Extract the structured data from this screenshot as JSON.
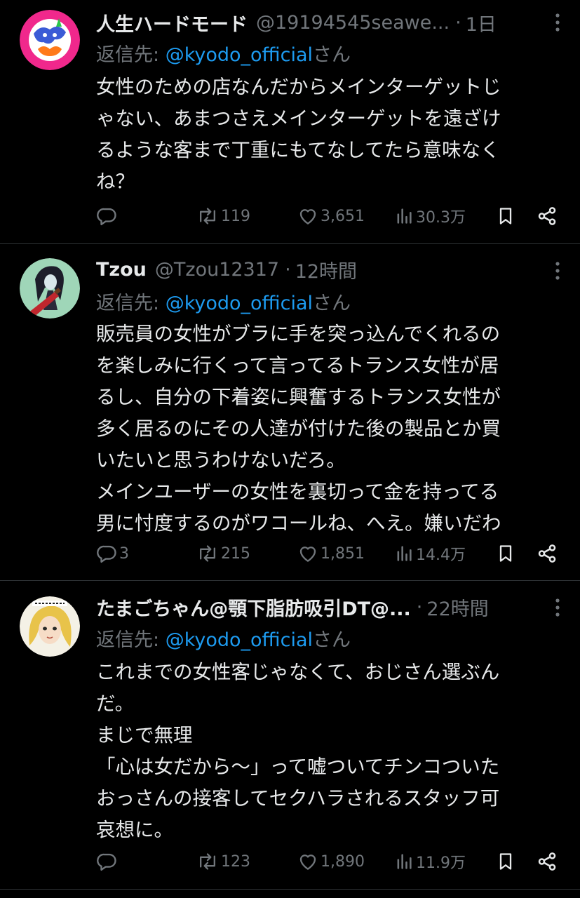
{
  "colors": {
    "background": "#000000",
    "text": "#e7e9ea",
    "muted": "#71767b",
    "link": "#1d9bf0",
    "divider": "#2f3336"
  },
  "tweets": [
    {
      "display_name": "人生ハードモード",
      "handle": "@19194545seawe...",
      "separator": "·",
      "time": "1日",
      "reply_prefix": "返信先: ",
      "reply_to": "@kyodo_official",
      "reply_suffix": "さん",
      "text_lines": [
        "女性のための店なんだからメインターゲットじ",
        "ゃない、あまつさえメインターゲットを遠ざけ",
        "るような客まで丁重にもてなしてたら意味なく",
        "ね？"
      ],
      "stats": {
        "replies": "",
        "retweets": "119",
        "likes": "3,651",
        "views": "30.3万"
      },
      "avatar_icon": "avatar-logo-icon"
    },
    {
      "display_name": "Tzou",
      "handle": "@Tzou12317",
      "separator": "·",
      "time": "12時間",
      "reply_prefix": "返信先: ",
      "reply_to": "@kyodo_official",
      "reply_suffix": "さん",
      "text_lines": [
        "販売員の女性がブラに手を突っ込んでくれるの",
        "を楽しみに行くって言ってるトランス女性が居",
        "るし、自分の下着姿に興奮するトランス女性が",
        "多く居るのにその人達が付けた後の製品とか買",
        "いたいと思うわけないだろ。",
        "メインユーザーの女性を裏切って金を持ってる",
        "男に忖度するのがワコールね、へえ。嫌いだわ"
      ],
      "stats": {
        "replies": "3",
        "retweets": "215",
        "likes": "1,851",
        "views": "14.4万"
      },
      "avatar_icon": "avatar-character-icon"
    },
    {
      "display_name": "たまごちゃん@顎下脂肪吸引DT@...",
      "handle": "",
      "separator": "·",
      "time": "22時間",
      "reply_prefix": "返信先: ",
      "reply_to": "@kyodo_official",
      "reply_suffix": "さん",
      "text_lines": [
        "これまでの女性客じゃなくて、おじさん選ぶん",
        "だ。",
        "まじで無理",
        "「心は女だから〜」って嘘ついてチンコついた",
        "おっさんの接客してセクハラされるスタッフ可",
        "哀想に。"
      ],
      "stats": {
        "replies": "",
        "retweets": "123",
        "likes": "1,890",
        "views": "11.9万"
      },
      "avatar_icon": "avatar-anime-girl-icon"
    }
  ]
}
